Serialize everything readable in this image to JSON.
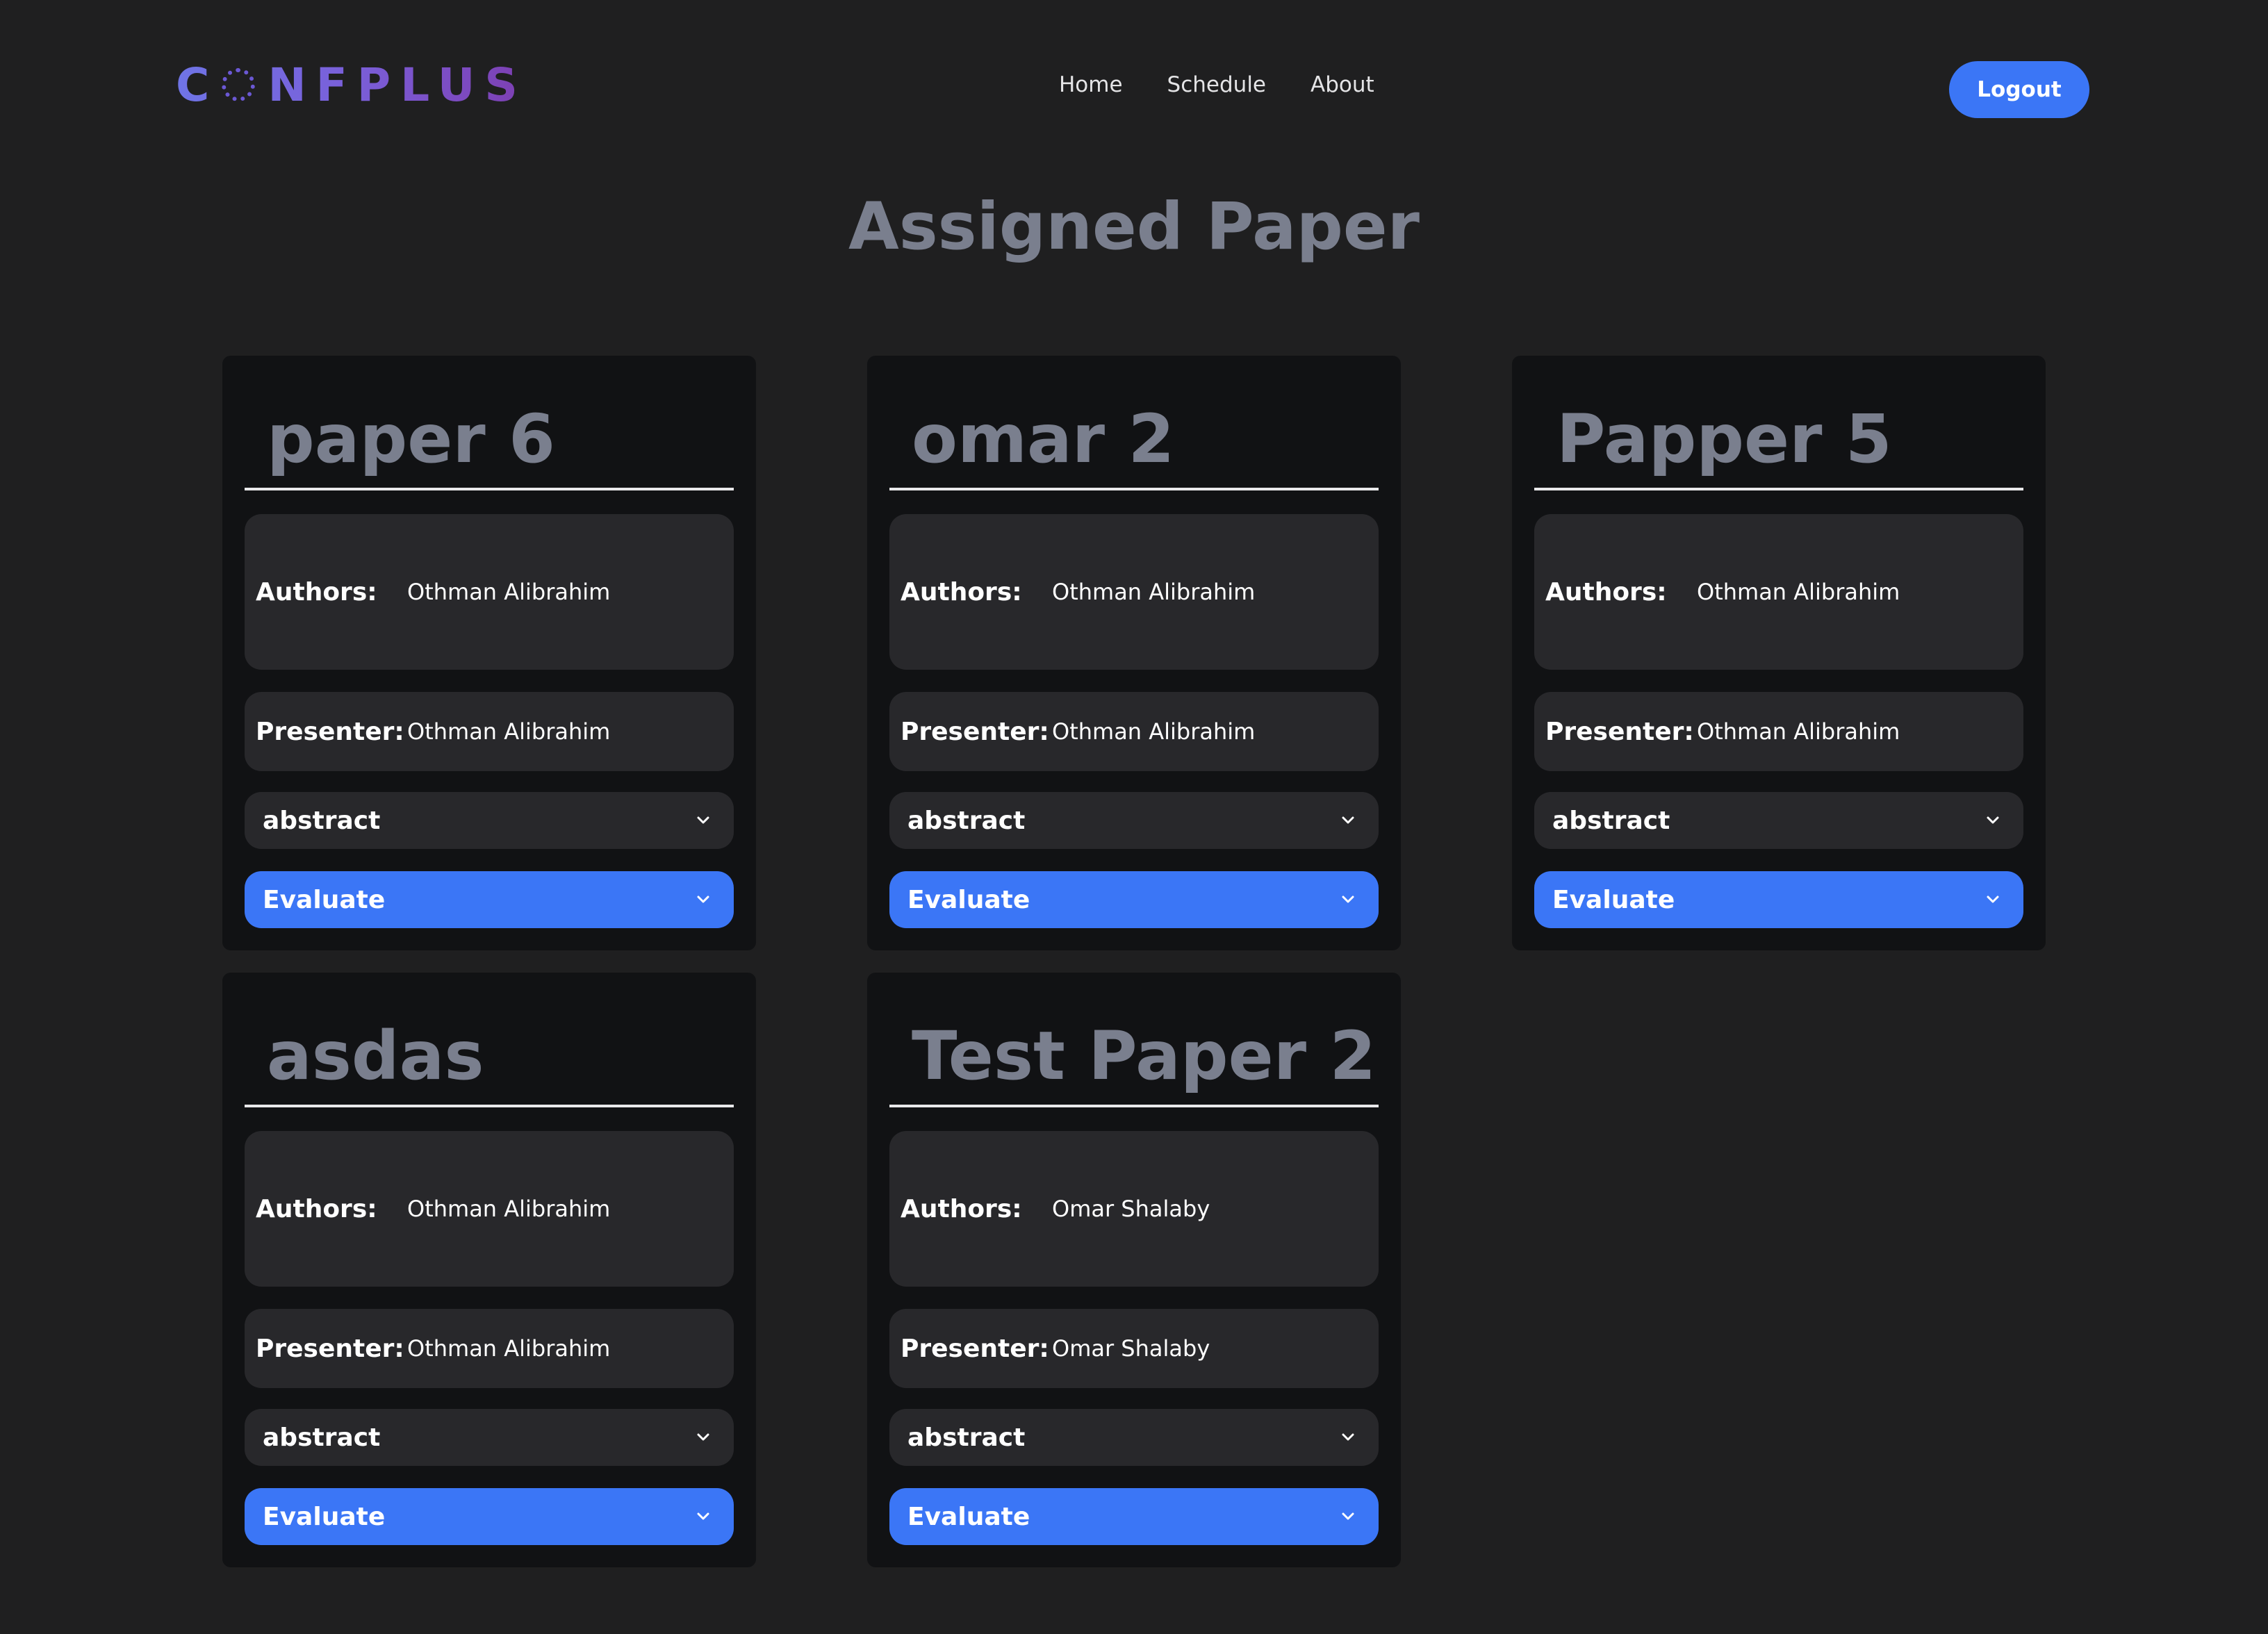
{
  "header": {
    "logo_text": "CONFPLUS",
    "nav": [
      "Home",
      "Schedule",
      "About"
    ],
    "logout_label": "Logout"
  },
  "page_title": "Assigned Paper",
  "field_labels": {
    "authors": "Authors:",
    "presenter": "Presenter:",
    "abstract": "abstract",
    "evaluate": "Evaluate"
  },
  "papers": [
    {
      "title": "paper 6",
      "authors": "Othman Alibrahim",
      "presenter": "Othman Alibrahim"
    },
    {
      "title": "omar 2",
      "authors": "Othman Alibrahim",
      "presenter": "Othman Alibrahim"
    },
    {
      "title": "Papper 5",
      "authors": "Othman Alibrahim",
      "presenter": "Othman Alibrahim"
    },
    {
      "title": "asdas",
      "authors": "Othman Alibrahim",
      "presenter": "Othman Alibrahim"
    },
    {
      "title": "Test Paper 2",
      "authors": "Omar Shalaby",
      "presenter": "Omar Shalaby"
    }
  ],
  "colors": {
    "background": "#1f1f20",
    "card": "#111214",
    "field": "#28282b",
    "accent": "#3b76f6",
    "title": "#7a7f8e"
  },
  "icons": {
    "logo_ring": "logo-ring-icon",
    "dropdown": "chevron-down-icon"
  }
}
